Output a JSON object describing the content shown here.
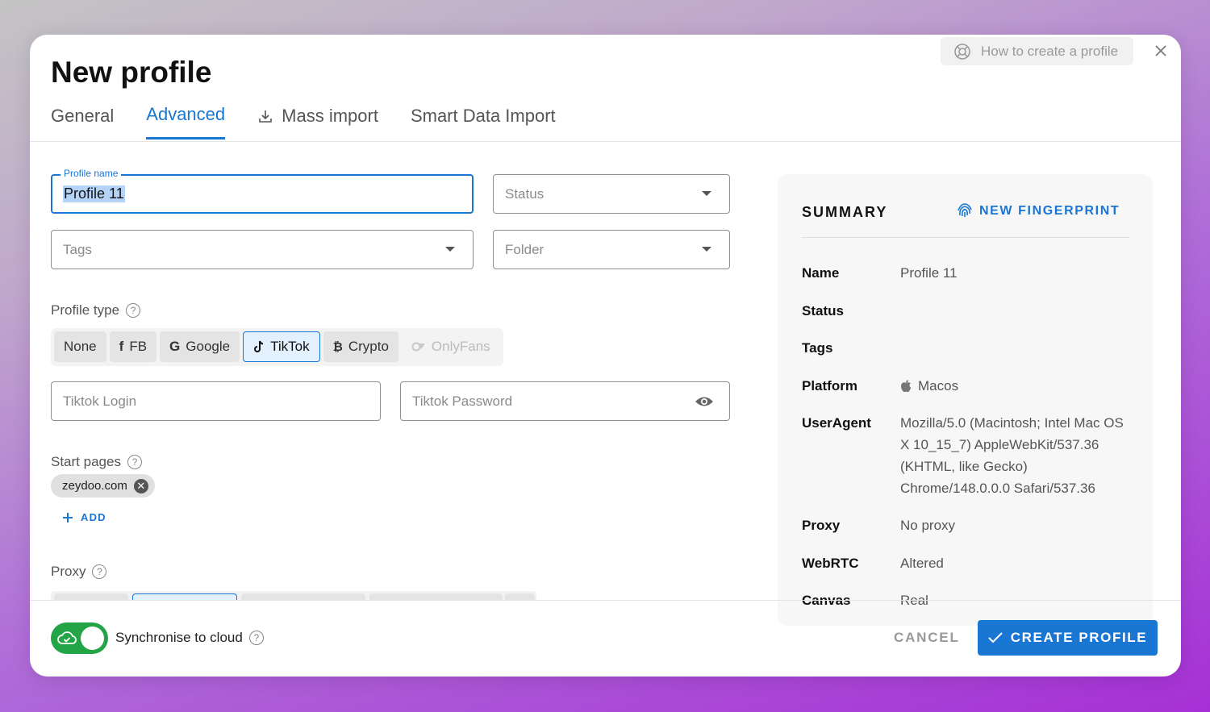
{
  "dialog": {
    "title": "New profile",
    "help_link": "How to create a profile",
    "tabs": [
      {
        "label": "General"
      },
      {
        "label": "Advanced"
      },
      {
        "label": "Mass import"
      },
      {
        "label": "Smart Data Import"
      }
    ],
    "active_tab": "Advanced"
  },
  "form": {
    "profile_name": {
      "label": "Profile name",
      "value": "Profile 11"
    },
    "status": {
      "placeholder": "Status"
    },
    "tags": {
      "placeholder": "Tags"
    },
    "folder": {
      "placeholder": "Folder"
    },
    "profile_type": {
      "label": "Profile type",
      "options": [
        "None",
        "FB",
        "Google",
        "TikTok",
        "Crypto",
        "OnlyFans"
      ],
      "selected": "TikTok"
    },
    "tiktok_login": {
      "placeholder": "Tiktok Login"
    },
    "tiktok_password": {
      "placeholder": "Tiktok Password"
    },
    "start_pages": {
      "label": "Start pages",
      "items": [
        "zeydoo.com"
      ],
      "add_label": "ADD"
    },
    "proxy": {
      "label": "Proxy"
    }
  },
  "summary": {
    "title": "SUMMARY",
    "new_fingerprint": "NEW FINGERPRINT",
    "rows": [
      {
        "key": "Name",
        "value": "Profile 11"
      },
      {
        "key": "Status",
        "value": ""
      },
      {
        "key": "Tags",
        "value": ""
      },
      {
        "key": "Platform",
        "value": "Macos"
      },
      {
        "key": "UserAgent",
        "value": "Mozilla/5.0 (Macintosh; Intel Mac OS X 10_15_7) AppleWebKit/537.36 (KHTML, like Gecko) Chrome/148.0.0.0 Safari/537.36"
      },
      {
        "key": "Proxy",
        "value": "No proxy"
      },
      {
        "key": "WebRTC",
        "value": "Altered"
      },
      {
        "key": "Canvas",
        "value": "Real"
      }
    ]
  },
  "footer": {
    "sync_label": "Synchronise to cloud",
    "sync_enabled": true,
    "cancel_label": "CANCEL",
    "create_label": "CREATE PROFILE"
  },
  "colors": {
    "accent": "#1976d2",
    "toggle_on": "#22a447"
  }
}
